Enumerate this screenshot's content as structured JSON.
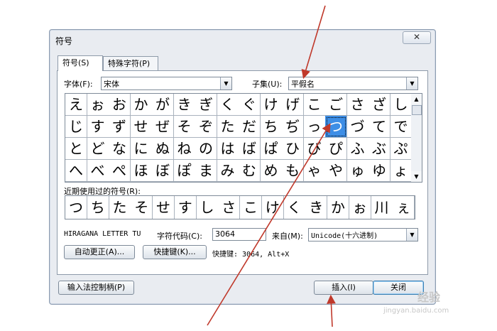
{
  "window": {
    "title": "符号",
    "close_label": "✕"
  },
  "tabs": [
    {
      "label": "符号(S)"
    },
    {
      "label": "特殊字符(P)"
    }
  ],
  "font": {
    "label": "字体(F):",
    "value": "宋体"
  },
  "subset": {
    "label": "子集(U):",
    "value": "平假名"
  },
  "grid": {
    "rows": [
      [
        "え",
        "ぉ",
        "お",
        "か",
        "が",
        "き",
        "ぎ",
        "く",
        "ぐ",
        "け",
        "げ",
        "こ",
        "ご",
        "さ",
        "ざ",
        "し"
      ],
      [
        "じ",
        "す",
        "ず",
        "せ",
        "ぜ",
        "そ",
        "ぞ",
        "た",
        "だ",
        "ち",
        "ぢ",
        "っ",
        "つ",
        "づ",
        "て",
        "で"
      ],
      [
        "と",
        "ど",
        "な",
        "に",
        "ぬ",
        "ね",
        "の",
        "は",
        "ば",
        "ぱ",
        "ひ",
        "び",
        "ぴ",
        "ふ",
        "ぶ",
        "ぷ"
      ],
      [
        "へ",
        "べ",
        "ぺ",
        "ほ",
        "ぼ",
        "ぽ",
        "ま",
        "み",
        "む",
        "め",
        "も",
        "ゃ",
        "や",
        "ゅ",
        "ゆ",
        "ょ"
      ]
    ],
    "selected": "つ"
  },
  "recent": {
    "label": "近期使用过的符号(R):",
    "chars": [
      "つ",
      "ち",
      "た",
      "そ",
      "せ",
      "す",
      "し",
      "さ",
      "こ",
      "け",
      "く",
      "き",
      "か",
      "ぉ",
      "川",
      "ぇ"
    ]
  },
  "char_name": "HIRAGANA LETTER TU",
  "char_code": {
    "label": "字符代码(C):",
    "value": "3064"
  },
  "from": {
    "label": "来自(M):",
    "value": "Unicode(十六进制)"
  },
  "buttons": {
    "autocorrect": "自动更正(A)...",
    "shortcut": "快捷键(K)...",
    "shortcut_text": "快捷键: 3064, Alt+X",
    "ime": "输入法控制柄(P)",
    "insert": "插入(I)",
    "close": "关闭"
  },
  "watermark": {
    "main": "经验",
    "sub": "jingyan.baidu.com"
  },
  "colors": {
    "selection": "#3d8ee6",
    "annotation_arrow": "#c0392b"
  }
}
